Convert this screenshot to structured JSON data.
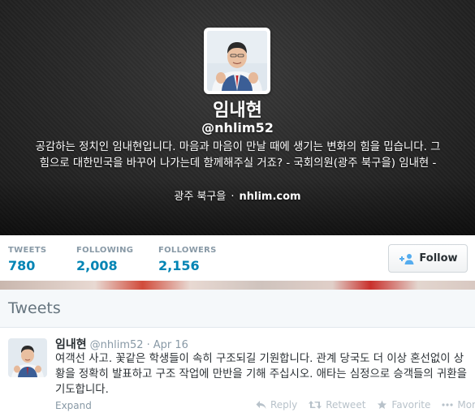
{
  "profile": {
    "name": "임내현",
    "handle": "@nhlim52",
    "bio": "공감하는 정치인 임내현입니다. 마음과 마음이 만날 때에 생기는 변화의 힘을 밉습니다. 그 힘으로 대한민국을 바꾸어 나가는데 함께해주실 거죠? - 국회의원(광주 북구을) 임내현 -",
    "location": "광주 북구을",
    "separator": "·",
    "url": "nhlim.com"
  },
  "stats": {
    "tweets": {
      "label": "TWEETS",
      "value": "780"
    },
    "following": {
      "label": "FOLLOWING",
      "value": "2,008"
    },
    "followers": {
      "label": "FOLLOWERS",
      "value": "2,156"
    }
  },
  "follow_button": {
    "label": "Follow",
    "icon": "follow-person-plus-icon"
  },
  "tweets_section": {
    "title": "Tweets"
  },
  "tweet": {
    "name": "임내현",
    "handle": "@nhlim52",
    "dot": "·",
    "time": "Apr 16",
    "text": "여객선 사고. 꽃같은 학생들이 속히 구조되길 기원합니다. 관계 당국도 더 이상 혼선없이 상황을 정확히 발표하고 구조 작업에 만반을 기해 주십시오. 애타는 심정으로 승객들의 귀환을 기도합니다.",
    "expand": "Expand",
    "actions": {
      "reply": "Reply",
      "retweet": "Retweet",
      "favorite": "Favorite",
      "more": "More"
    }
  },
  "colors": {
    "link": "#0084b4",
    "muted": "#8899a6",
    "action": "#b8c2ca"
  }
}
